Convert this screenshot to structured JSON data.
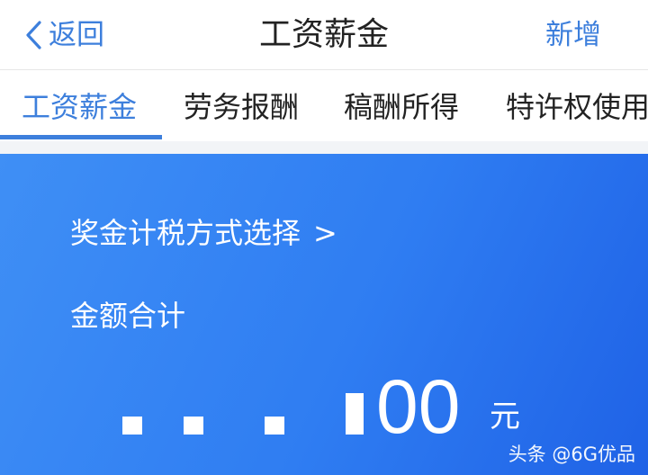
{
  "nav": {
    "back_label": "返回",
    "title": "工资薪金",
    "action_label": "新增"
  },
  "tabs": [
    {
      "label": "工资薪金",
      "active": true
    },
    {
      "label": "劳务报酬",
      "active": false
    },
    {
      "label": "稿酬所得",
      "active": false
    },
    {
      "label": "特许权使用",
      "active": false
    }
  ],
  "card": {
    "bonus_tax_link": "奖金计税方式选择",
    "bonus_tax_chevron": ">",
    "total_label": "金额合计",
    "amount_visible": "00",
    "unit": "元"
  },
  "watermark": "头条 @6G优品",
  "colors": {
    "accent": "#3d7fdc",
    "card_gradient_start": "#3f8ff5",
    "card_gradient_end": "#1f62e6"
  },
  "icons": {
    "back": "chevron-left-icon"
  }
}
